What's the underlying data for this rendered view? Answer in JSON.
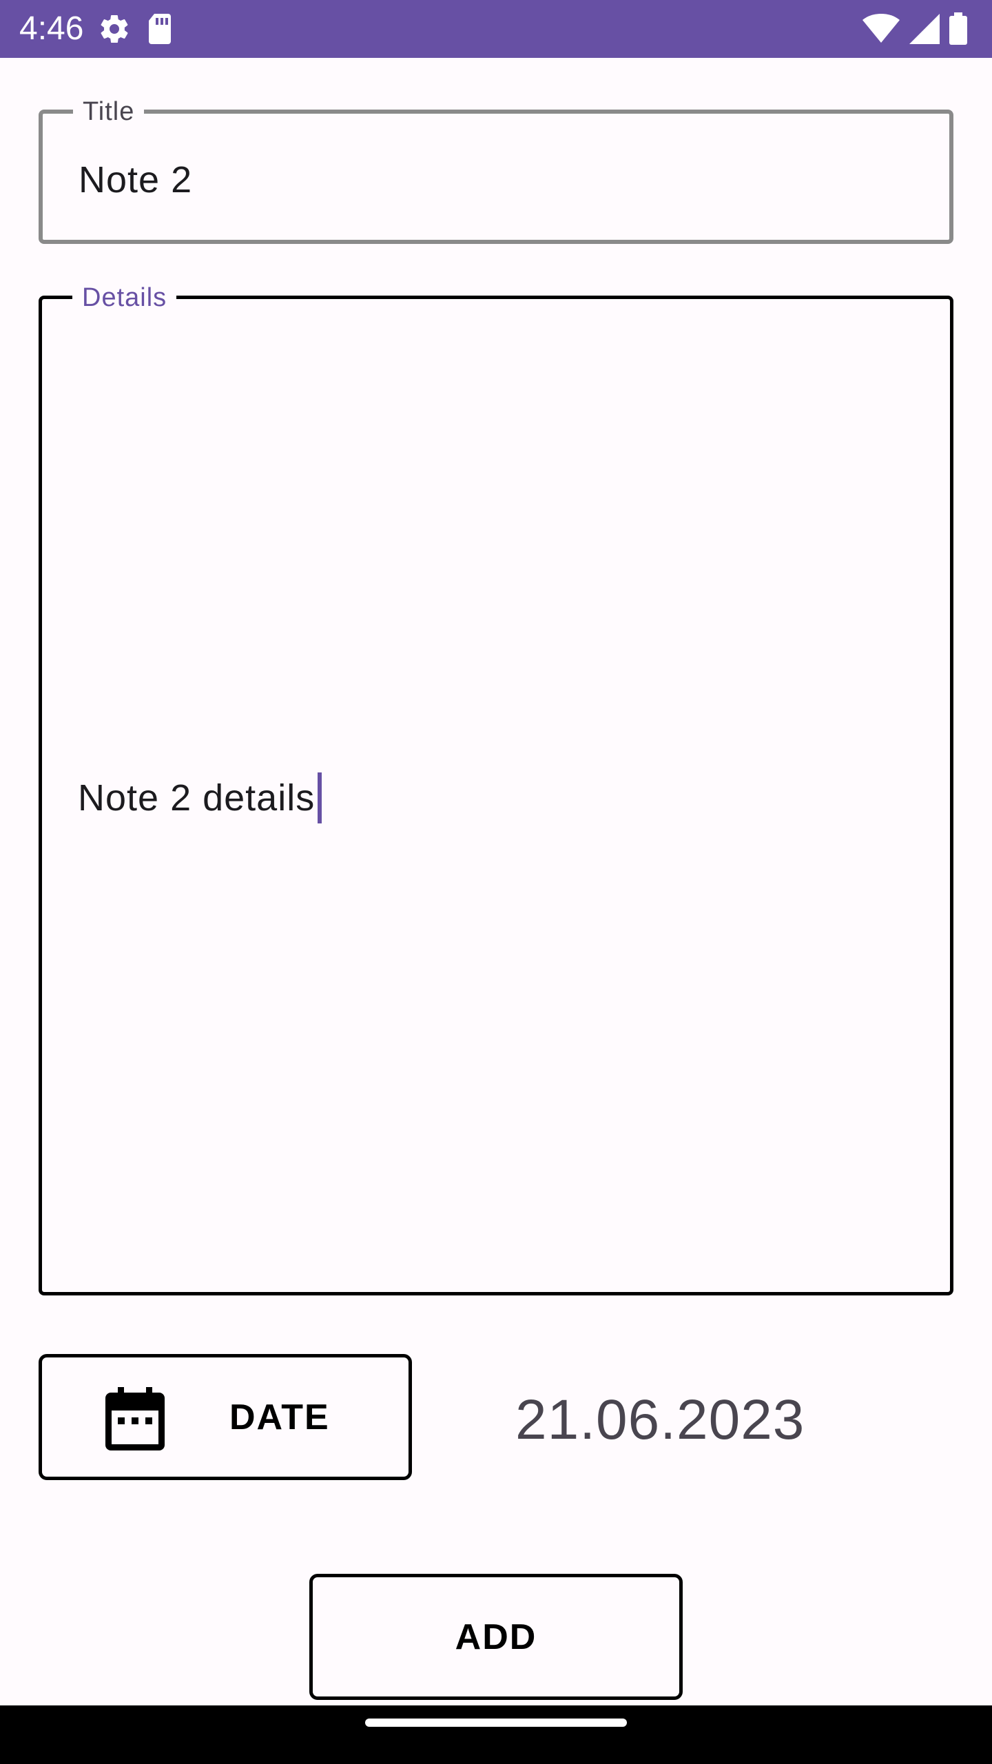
{
  "status_bar": {
    "time": "4:46",
    "background_color": "#6750a4",
    "left_icons": [
      "settings-gear-icon",
      "sd-card-icon"
    ],
    "right_icons": [
      "wifi-icon",
      "cell-signal-icon",
      "battery-icon"
    ]
  },
  "form": {
    "title_field": {
      "label": "Title",
      "value": "Note 2"
    },
    "details_field": {
      "label": "Details",
      "value": "Note 2 details"
    },
    "date_button": {
      "label": "DATE",
      "icon": "calendar-icon"
    },
    "date_value": "21.06.2023",
    "add_button": {
      "label": "ADD"
    }
  },
  "colors": {
    "accent": "#6750a4",
    "background": "#fffbfe",
    "text": "#1c1b1f",
    "muted_text": "#49454f"
  }
}
